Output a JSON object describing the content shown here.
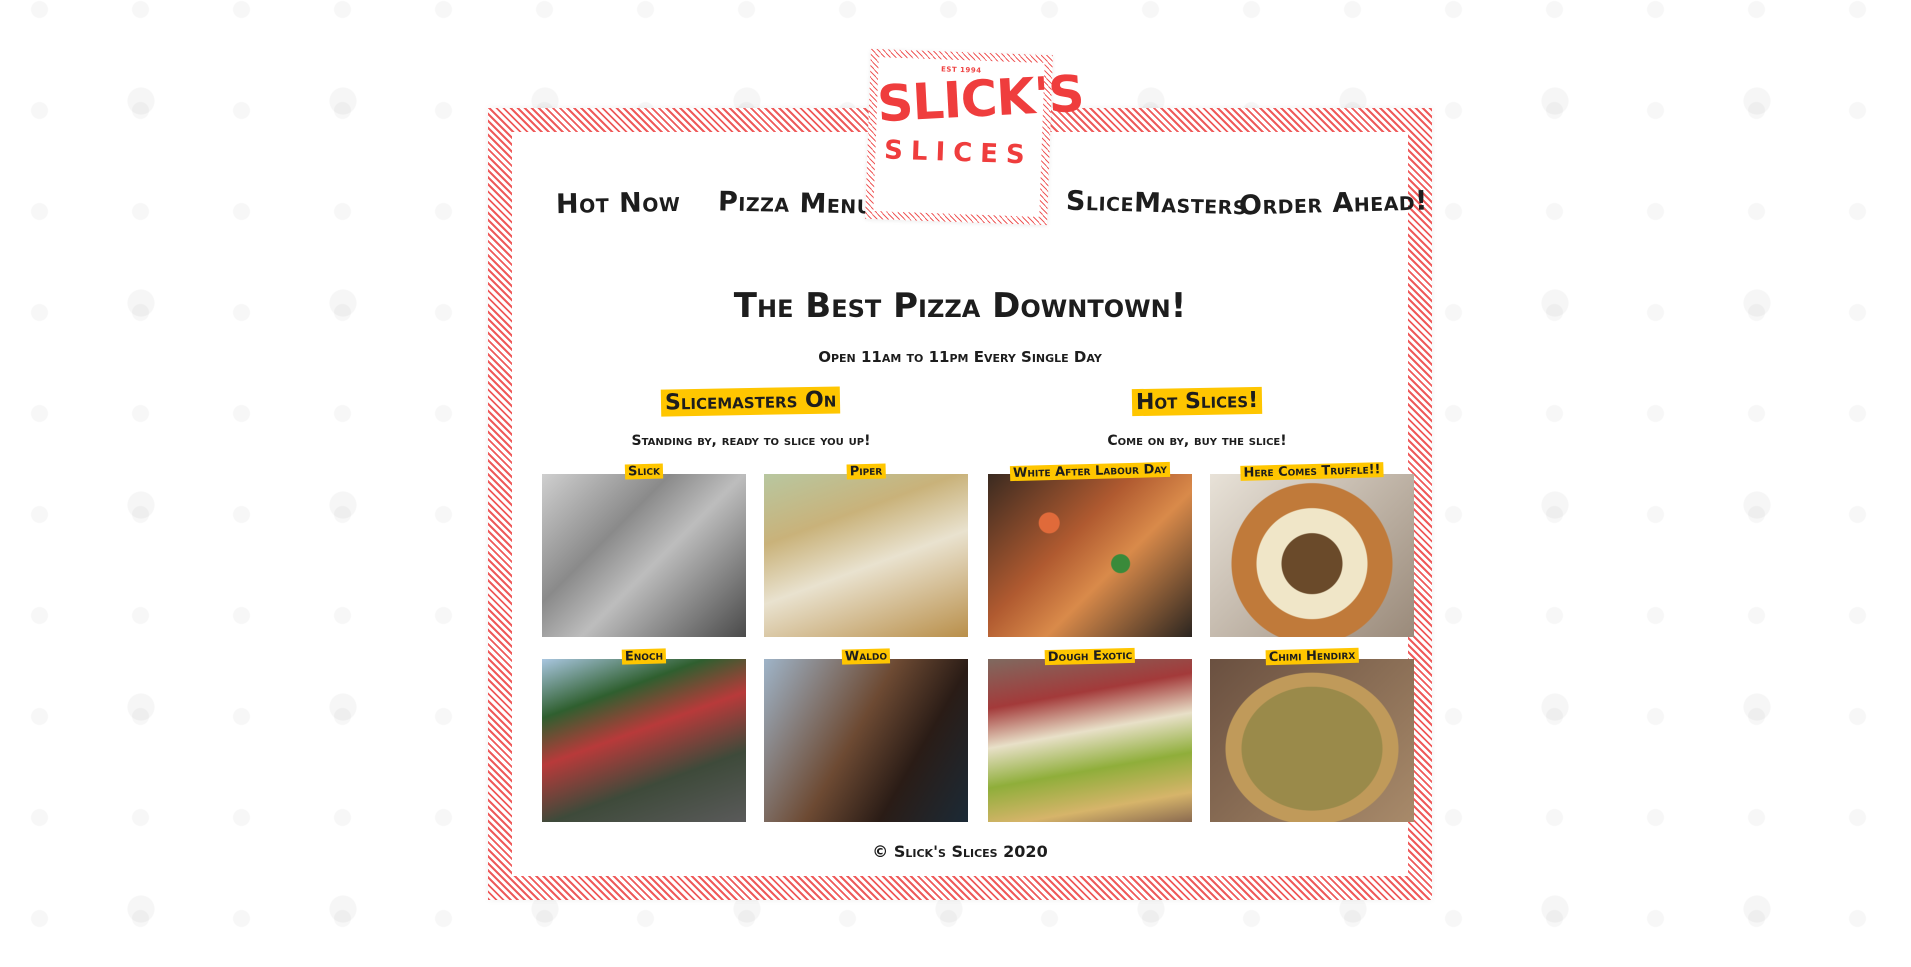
{
  "nav": {
    "hot_now": "Hot Now",
    "pizza_menu": "Pizza Menu",
    "slicemasters": "SliceMasters",
    "order_ahead": "Order Ahead!"
  },
  "logo": {
    "est": "EST 1994",
    "main": "SLICK'S",
    "sub": "SLICES",
    "color": "#ef3d3d"
  },
  "hero": {
    "title": "The Best Pizza Downtown!",
    "subtitle": "Open 11am to 11pm Every Single Day"
  },
  "slicemasters": {
    "heading": "Slicemasters On",
    "subheading": "Standing by, ready to slice you up!",
    "people": [
      {
        "name": "Slick"
      },
      {
        "name": "Piper"
      },
      {
        "name": "Enoch"
      },
      {
        "name": "Waldo"
      }
    ]
  },
  "hot_slices": {
    "heading": "Hot Slices!",
    "subheading": "Come on by, buy the slice!",
    "pizzas": [
      {
        "name": "White After Labour Day"
      },
      {
        "name": "Here Comes Truffle!!"
      },
      {
        "name": "Dough Exotic"
      },
      {
        "name": "Chimi Hendirx"
      }
    ]
  },
  "footer": {
    "text": "© Slick's Slices 2020"
  },
  "colors": {
    "accent_red": "#ef5b5b",
    "highlight_yellow": "#ffc600",
    "text_dark": "#1d1d1d"
  }
}
